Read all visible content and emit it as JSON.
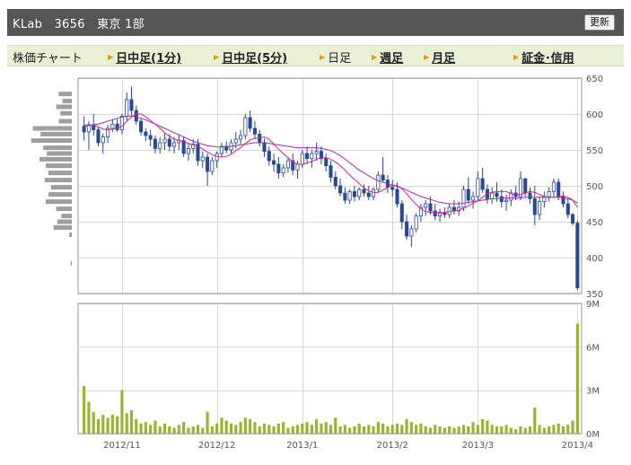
{
  "header": {
    "title": "KLab　3656　東京 1部",
    "refresh_label": "更新"
  },
  "nav": {
    "items": [
      {
        "label": "株価チャート",
        "kind": "head"
      },
      {
        "label": "日中足(1分)",
        "kind": "link"
      },
      {
        "label": "日中足(5分)",
        "kind": "link"
      },
      {
        "label": "日足",
        "kind": "plain"
      },
      {
        "label": "週足",
        "kind": "link"
      },
      {
        "label": "月足",
        "kind": "link"
      },
      {
        "label": "証金･信用",
        "kind": "link"
      }
    ]
  },
  "colors": {
    "candle_up": "#2a4a90",
    "candle_down": "#2a4a90",
    "ma_short": "#d0288a",
    "ma_long": "#9b2fb5",
    "volume": "#99b433",
    "profile": "#9e9e9e",
    "grid": "#d8d8d8"
  },
  "chart_data": {
    "type": "candlestick",
    "price_axis": {
      "ticks": [
        650,
        600,
        550,
        500,
        450,
        400,
        350
      ],
      "ylim": [
        350,
        650
      ]
    },
    "volume_axis": {
      "ticks": [
        "9M",
        "6M",
        "3M",
        "0M"
      ],
      "values": [
        9,
        6,
        3,
        0
      ],
      "ylim": [
        0,
        9
      ],
      "unit": "M"
    },
    "x_labels": [
      "2012/11",
      "2012/12",
      "2013/1",
      "2013/2",
      "2013/3",
      "2013/4"
    ],
    "x_label_index": [
      8,
      28,
      46,
      65,
      83,
      104
    ],
    "candles": [
      [
        583,
        597,
        563,
        575
      ],
      [
        575,
        590,
        550,
        585
      ],
      [
        585,
        600,
        570,
        578
      ],
      [
        578,
        582,
        555,
        560
      ],
      [
        560,
        573,
        545,
        568
      ],
      [
        568,
        585,
        560,
        580
      ],
      [
        580,
        592,
        575,
        586
      ],
      [
        586,
        593,
        575,
        578
      ],
      [
        578,
        600,
        572,
        597
      ],
      [
        597,
        630,
        590,
        620
      ],
      [
        620,
        638,
        598,
        605
      ],
      [
        605,
        612,
        585,
        590
      ],
      [
        590,
        595,
        570,
        575
      ],
      [
        575,
        580,
        562,
        570
      ],
      [
        570,
        578,
        555,
        565
      ],
      [
        565,
        570,
        545,
        552
      ],
      [
        552,
        568,
        545,
        560
      ],
      [
        560,
        573,
        550,
        565
      ],
      [
        565,
        572,
        548,
        555
      ],
      [
        555,
        568,
        545,
        560
      ],
      [
        560,
        572,
        550,
        563
      ],
      [
        563,
        568,
        540,
        545
      ],
      [
        545,
        560,
        535,
        552
      ],
      [
        552,
        565,
        545,
        558
      ],
      [
        558,
        565,
        528,
        535
      ],
      [
        535,
        548,
        525,
        540
      ],
      [
        540,
        545,
        500,
        520
      ],
      [
        520,
        540,
        515,
        535
      ],
      [
        535,
        548,
        525,
        545
      ],
      [
        545,
        560,
        540,
        555
      ],
      [
        555,
        562,
        545,
        550
      ],
      [
        550,
        565,
        545,
        560
      ],
      [
        560,
        575,
        552,
        565
      ],
      [
        565,
        578,
        558,
        570
      ],
      [
        570,
        600,
        565,
        595
      ],
      [
        595,
        605,
        575,
        580
      ],
      [
        580,
        590,
        565,
        572
      ],
      [
        572,
        578,
        555,
        560
      ],
      [
        560,
        566,
        540,
        548
      ],
      [
        548,
        555,
        528,
        535
      ],
      [
        535,
        545,
        520,
        530
      ],
      [
        530,
        540,
        510,
        518
      ],
      [
        518,
        530,
        512,
        525
      ],
      [
        525,
        540,
        518,
        535
      ],
      [
        535,
        545,
        515,
        522
      ],
      [
        522,
        535,
        510,
        530
      ],
      [
        530,
        550,
        525,
        545
      ],
      [
        545,
        555,
        530,
        538
      ],
      [
        538,
        550,
        525,
        545
      ],
      [
        545,
        560,
        535,
        548
      ],
      [
        548,
        555,
        530,
        538
      ],
      [
        538,
        545,
        520,
        528
      ],
      [
        528,
        535,
        505,
        512
      ],
      [
        512,
        520,
        495,
        500
      ],
      [
        500,
        510,
        485,
        490
      ],
      [
        490,
        498,
        475,
        480
      ],
      [
        480,
        495,
        475,
        492
      ],
      [
        492,
        500,
        478,
        485
      ],
      [
        485,
        498,
        480,
        495
      ],
      [
        495,
        502,
        485,
        490
      ],
      [
        490,
        500,
        480,
        485
      ],
      [
        485,
        498,
        480,
        495
      ],
      [
        495,
        520,
        490,
        515
      ],
      [
        515,
        540,
        505,
        508
      ],
      [
        508,
        515,
        490,
        498
      ],
      [
        498,
        508,
        485,
        495
      ],
      [
        495,
        505,
        470,
        475
      ],
      [
        475,
        480,
        440,
        450
      ],
      [
        450,
        460,
        425,
        430
      ],
      [
        430,
        445,
        415,
        440
      ],
      [
        440,
        462,
        435,
        458
      ],
      [
        458,
        475,
        450,
        470
      ],
      [
        470,
        480,
        458,
        475
      ],
      [
        475,
        485,
        460,
        465
      ],
      [
        465,
        475,
        452,
        458
      ],
      [
        458,
        468,
        450,
        462
      ],
      [
        462,
        470,
        455,
        460
      ],
      [
        460,
        475,
        455,
        470
      ],
      [
        470,
        480,
        460,
        465
      ],
      [
        465,
        478,
        458,
        470
      ],
      [
        470,
        500,
        465,
        495
      ],
      [
        495,
        512,
        475,
        480
      ],
      [
        480,
        492,
        468,
        485
      ],
      [
        485,
        520,
        480,
        510
      ],
      [
        510,
        525,
        490,
        495
      ],
      [
        495,
        502,
        475,
        482
      ],
      [
        482,
        498,
        475,
        490
      ],
      [
        490,
        505,
        478,
        485
      ],
      [
        485,
        495,
        470,
        478
      ],
      [
        478,
        488,
        465,
        480
      ],
      [
        480,
        495,
        472,
        490
      ],
      [
        490,
        500,
        480,
        485
      ],
      [
        485,
        520,
        480,
        510
      ],
      [
        510,
        505,
        485,
        490
      ],
      [
        490,
        498,
        475,
        482
      ],
      [
        482,
        500,
        445,
        460
      ],
      [
        460,
        485,
        452,
        478
      ],
      [
        478,
        492,
        470,
        485
      ],
      [
        485,
        498,
        478,
        492
      ],
      [
        492,
        510,
        485,
        505
      ],
      [
        505,
        510,
        480,
        485
      ],
      [
        485,
        492,
        470,
        475
      ],
      [
        475,
        482,
        455,
        460
      ],
      [
        460,
        462,
        445,
        448
      ],
      [
        448,
        452,
        355,
        358
      ]
    ],
    "ma_short": [
      585,
      584,
      584,
      582,
      579,
      578,
      579,
      580,
      583,
      590,
      596,
      600,
      600,
      596,
      591,
      586,
      580,
      574,
      569,
      565,
      563,
      562,
      559,
      557,
      555,
      551,
      547,
      543,
      541,
      540,
      541,
      544,
      549,
      553,
      559,
      564,
      566,
      567,
      568,
      565,
      558,
      551,
      545,
      539,
      533,
      530,
      530,
      532,
      534,
      537,
      539,
      539,
      537,
      533,
      528,
      522,
      515,
      509,
      503,
      497,
      493,
      491,
      491,
      494,
      498,
      501,
      500,
      496,
      489,
      481,
      474,
      468,
      464,
      463,
      463,
      463,
      463,
      464,
      465,
      466,
      469,
      472,
      476,
      479,
      484,
      489,
      491,
      492,
      492,
      492,
      489,
      487,
      488,
      490,
      492,
      491,
      488,
      485,
      484,
      484,
      485,
      486,
      484,
      480,
      470
    ],
    "ma_long": [
      583,
      584,
      585,
      586,
      588,
      590,
      592,
      594,
      596,
      597,
      597,
      596,
      594,
      592,
      589,
      586,
      583,
      580,
      577,
      574,
      571,
      568,
      565,
      562,
      560,
      558,
      556,
      555,
      554,
      554,
      554,
      555,
      556,
      557,
      558,
      559,
      560,
      560,
      560,
      559,
      558,
      557,
      556,
      555,
      554,
      553,
      553,
      553,
      553,
      553,
      552,
      551,
      549,
      546,
      542,
      537,
      532,
      527,
      522,
      518,
      514,
      510,
      507,
      505,
      503,
      501,
      499,
      497,
      494,
      491,
      488,
      485,
      483,
      481,
      479,
      477,
      476,
      475,
      475,
      475,
      476,
      477,
      478,
      479,
      480,
      481,
      482,
      482,
      483,
      483,
      483,
      483,
      483,
      484,
      484,
      484,
      484,
      484,
      484,
      484,
      484,
      483,
      482,
      480,
      476
    ],
    "volume": [
      3.3,
      2.2,
      1.5,
      1.0,
      1.3,
      1.1,
      1.3,
      1.2,
      3.0,
      1.4,
      1.6,
      1.0,
      0.7,
      0.8,
      0.6,
      0.9,
      0.5,
      0.7,
      0.5,
      0.4,
      0.6,
      0.8,
      0.4,
      0.5,
      0.6,
      0.4,
      1.5,
      0.5,
      0.7,
      1.1,
      0.9,
      0.7,
      0.6,
      0.8,
      1.1,
      1.0,
      0.8,
      0.5,
      0.7,
      0.6,
      0.5,
      0.7,
      0.8,
      0.4,
      0.5,
      0.6,
      0.7,
      0.8,
      0.6,
      1.0,
      0.7,
      0.8,
      0.6,
      1.1,
      0.5,
      0.6,
      0.4,
      0.5,
      0.7,
      0.5,
      0.6,
      0.5,
      0.8,
      0.7,
      0.5,
      0.6,
      0.7,
      0.6,
      1.0,
      0.8,
      0.6,
      0.7,
      0.5,
      0.4,
      0.6,
      0.5,
      0.4,
      0.5,
      0.4,
      0.5,
      0.6,
      0.5,
      0.8,
      0.6,
      1.0,
      0.9,
      0.6,
      0.5,
      0.5,
      0.6,
      0.4,
      0.3,
      0.5,
      0.4,
      0.5,
      1.8,
      0.6,
      0.4,
      0.5,
      0.6,
      0.7,
      0.5,
      0.6,
      0.9,
      7.6
    ],
    "volume_profile": [
      {
        "price": 628,
        "len": 0.25
      },
      {
        "price": 618,
        "len": 0.18
      },
      {
        "price": 610,
        "len": 0.3
      },
      {
        "price": 601,
        "len": 0.22
      },
      {
        "price": 590,
        "len": 0.25
      },
      {
        "price": 580,
        "len": 0.75
      },
      {
        "price": 572,
        "len": 0.6
      },
      {
        "price": 563,
        "len": 0.78
      },
      {
        "price": 553,
        "len": 0.55
      },
      {
        "price": 545,
        "len": 0.48
      },
      {
        "price": 537,
        "len": 0.62
      },
      {
        "price": 528,
        "len": 0.5
      },
      {
        "price": 518,
        "len": 0.45
      },
      {
        "price": 508,
        "len": 0.52
      },
      {
        "price": 498,
        "len": 0.4
      },
      {
        "price": 488,
        "len": 0.45
      },
      {
        "price": 478,
        "len": 0.5
      },
      {
        "price": 468,
        "len": 0.3
      },
      {
        "price": 458,
        "len": 0.2
      },
      {
        "price": 450,
        "len": 0.28
      },
      {
        "price": 442,
        "len": 0.35
      },
      {
        "price": 432,
        "len": 0.05
      },
      {
        "price": 392,
        "len": 0.02
      }
    ]
  }
}
